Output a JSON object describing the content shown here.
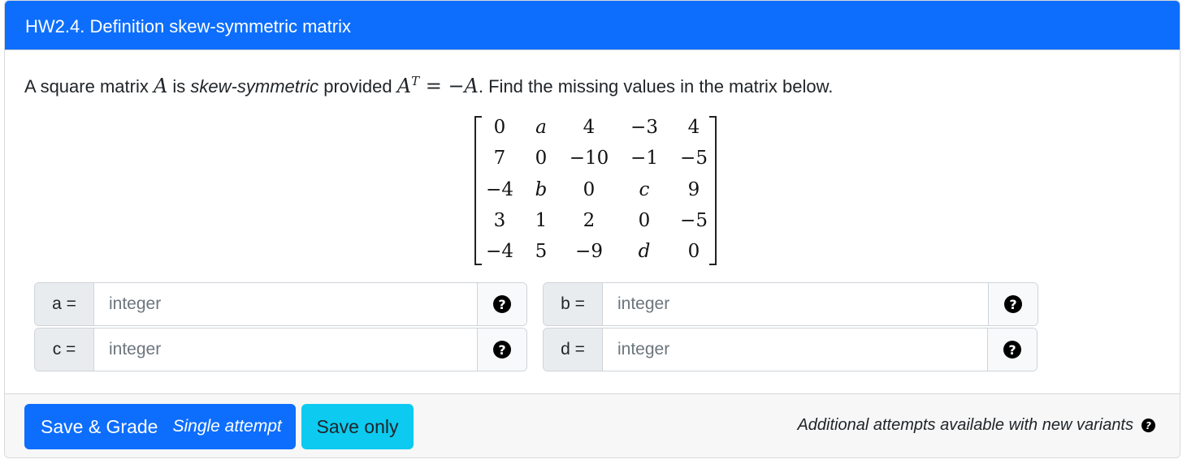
{
  "header": {
    "title": "HW2.4. Definition skew-symmetric matrix"
  },
  "prompt": {
    "text_1": "A square matrix ",
    "var_A": "A",
    "text_2": " is ",
    "emph": "skew-symmetric",
    "text_3": " provided ",
    "eq_lhs": "A",
    "eq_sup": "T",
    "eq_rest": " = −A",
    "text_4": ". Find the missing values in the matrix below."
  },
  "matrix": {
    "rows": [
      [
        "0",
        "a",
        "4",
        "−3",
        "4"
      ],
      [
        "7",
        "0",
        "−10",
        "−1",
        "−5"
      ],
      [
        "−4",
        "b",
        "0",
        "c",
        "9"
      ],
      [
        "3",
        "1",
        "2",
        "0",
        "−5"
      ],
      [
        "−4",
        "5",
        "−9",
        "d",
        "0"
      ]
    ]
  },
  "inputs": {
    "a": {
      "label": "a =",
      "placeholder": "integer",
      "value": ""
    },
    "b": {
      "label": "b =",
      "placeholder": "integer",
      "value": ""
    },
    "c": {
      "label": "c =",
      "placeholder": "integer",
      "value": ""
    },
    "d": {
      "label": "d =",
      "placeholder": "integer",
      "value": ""
    },
    "help_glyph": "?"
  },
  "footer": {
    "grade_label": "Save & Grade",
    "grade_sub": "Single attempt",
    "save_label": "Save only",
    "attempts_text": "Additional attempts available with new variants",
    "help_glyph": "?"
  },
  "colors": {
    "primary": "#0d6efd",
    "info": "#0dcaf0",
    "footer_bg": "#f7f7f7"
  },
  "icons": {
    "help": "question-circle-icon"
  }
}
